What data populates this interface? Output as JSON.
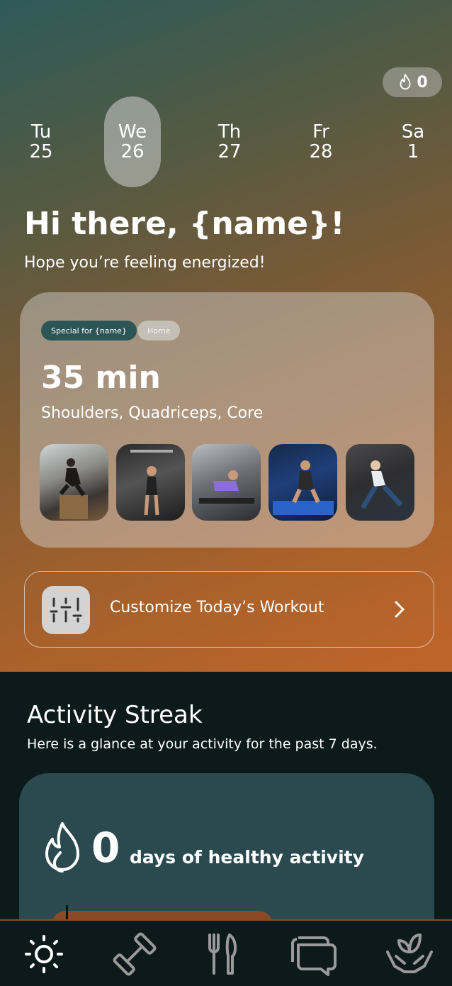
{
  "streak_badge": {
    "icon": "flame-icon",
    "count": "0"
  },
  "days": [
    {
      "abbr": "Tu",
      "num": "25",
      "active": false
    },
    {
      "abbr": "We",
      "num": "26",
      "active": true
    },
    {
      "abbr": "Th",
      "num": "27",
      "active": false
    },
    {
      "abbr": "Fr",
      "num": "28",
      "active": false
    },
    {
      "abbr": "Sa",
      "num": "1",
      "active": false
    }
  ],
  "greeting": {
    "title": "Hi there, {name}!",
    "subtitle": "Hope you’re feeling energized!"
  },
  "workout": {
    "tags": [
      "Special for {name}",
      "Home"
    ],
    "duration": "35 min",
    "muscles": "Shoulders, Quadriceps, Core"
  },
  "customize": {
    "label": "Customize Today’s Workout",
    "icon": "sliders-icon"
  },
  "activity": {
    "title": "Activity Streak",
    "subtitle": "Here is a glance at your activity for the past 7 days.",
    "count": "0",
    "text": "days of healthy activity"
  },
  "nav": [
    {
      "icon": "sun-icon",
      "active": true
    },
    {
      "icon": "dumbbell-icon",
      "active": false
    },
    {
      "icon": "fork-knife-icon",
      "active": false
    },
    {
      "icon": "chat-icon",
      "active": false
    },
    {
      "icon": "plant-hands-icon",
      "active": false
    }
  ],
  "colors": {
    "accent_teal": "#2c5557",
    "accent_orange": "#c0652a",
    "dark_bg": "#0d1a1b"
  }
}
